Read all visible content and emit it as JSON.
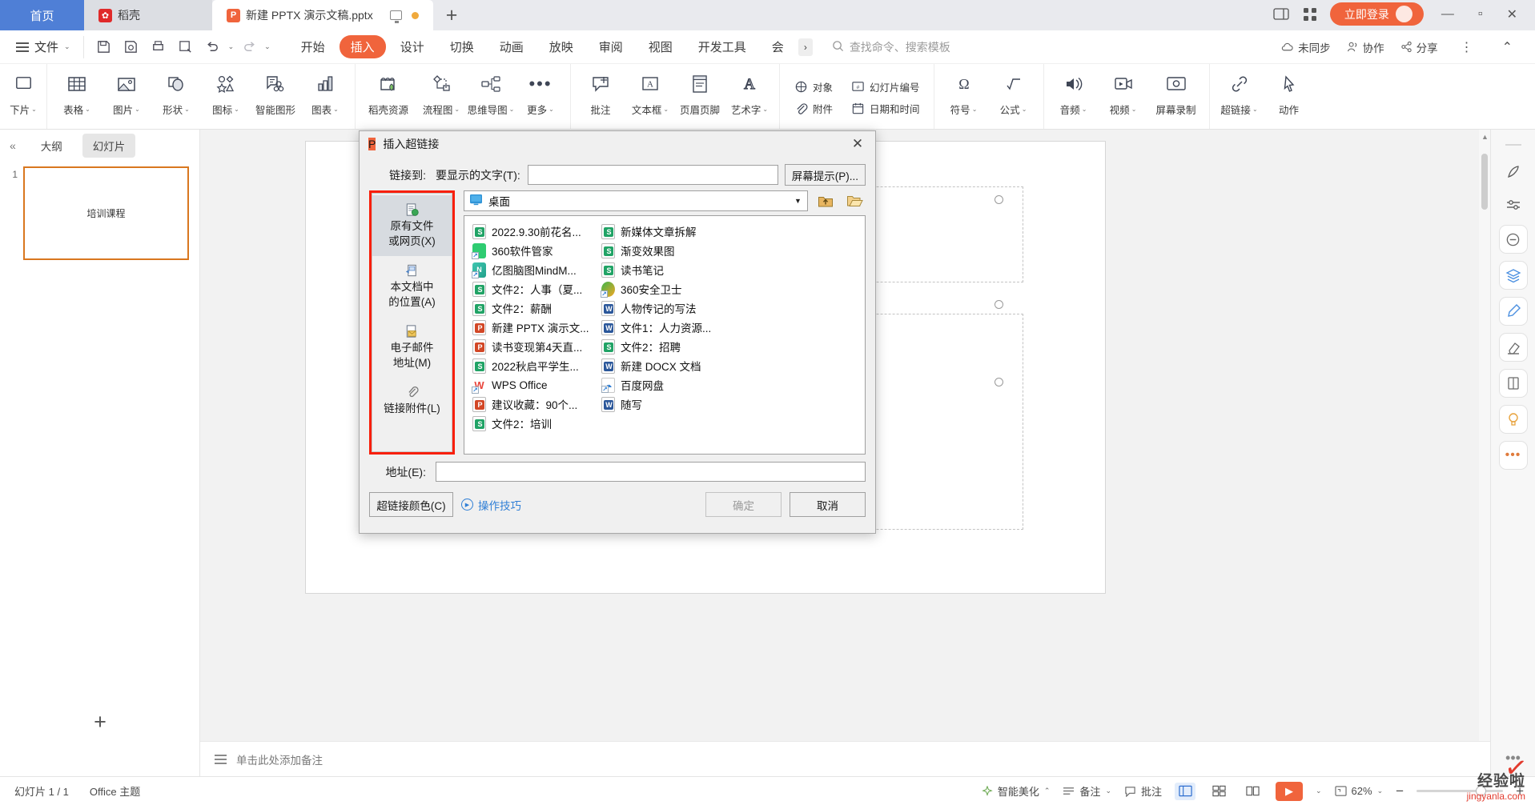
{
  "titlebar": {
    "home_tab": "首页",
    "daoke_tab": "稻壳",
    "doc_tab": "新建 PPTX 演示文稿.pptx",
    "login_label": "立即登录"
  },
  "menubar": {
    "file_label": "文件",
    "tabs": [
      "开始",
      "插入",
      "设计",
      "切换",
      "动画",
      "放映",
      "审阅",
      "视图",
      "开发工具",
      "会"
    ],
    "selected_tab": "插入",
    "more_arrow": "›",
    "search_placeholder": "查找命令、搜索模板",
    "right_items": [
      "未同步",
      "协作",
      "分享"
    ]
  },
  "ribbon": {
    "items": [
      {
        "label": "下片",
        "caret": "⌄"
      },
      {
        "label": "表格",
        "caret": "⌄"
      },
      {
        "label": "图片",
        "caret": "⌄"
      },
      {
        "label": "形状",
        "caret": "⌄"
      },
      {
        "label": "图标",
        "caret": "⌄"
      },
      {
        "label": "智能图形",
        "caret": ""
      },
      {
        "label": "图表",
        "caret": "⌄"
      },
      {
        "label": "稻壳资源",
        "caret": ""
      },
      {
        "label": "流程图",
        "caret": "⌄"
      },
      {
        "label": "思维导图",
        "caret": "⌄"
      },
      {
        "label": "更多",
        "caret": "⌄"
      },
      {
        "label": "批注",
        "caret": ""
      },
      {
        "label": "文本框",
        "caret": "⌄"
      },
      {
        "label": "页眉页脚",
        "caret": ""
      },
      {
        "label": "艺术字",
        "caret": "⌄"
      }
    ],
    "stack_a": [
      "对象",
      "幻灯片编号",
      "附件",
      "日期和时间"
    ],
    "items_tail": [
      {
        "label": "符号",
        "caret": "⌄"
      },
      {
        "label": "公式",
        "caret": "⌄"
      },
      {
        "label": "音频",
        "caret": "⌄"
      },
      {
        "label": "视频",
        "caret": "⌄"
      },
      {
        "label": "屏幕录制",
        "caret": ""
      },
      {
        "label": "超链接",
        "caret": "⌄"
      },
      {
        "label": "动作",
        "caret": ""
      }
    ]
  },
  "leftpanel": {
    "outline_tab": "大纲",
    "slides_tab": "幻灯片",
    "slide_number": "1",
    "slide_title": "培训课程",
    "add_slide": "+"
  },
  "notes": {
    "placeholder": "单击此处添加备注"
  },
  "status": {
    "slide_count": "幻灯片 1 / 1",
    "theme": "Office 主题",
    "beautify": "智能美化",
    "notes": "备注",
    "comments": "批注",
    "zoom": "62%",
    "zoom_out": "−",
    "zoom_in": "+"
  },
  "watermark": {
    "cn": "经验啦",
    "en": "jingyanla.com"
  },
  "dialog": {
    "title": "插入超链接",
    "close": "✕",
    "link_to_label": "链接到:",
    "display_text_label": "要显示的文字(T):",
    "display_text_value": "",
    "screen_tip_button": "屏幕提示(P)...",
    "sidebar": [
      {
        "label_line1": "原有文件",
        "label_line2": "或网页(X)",
        "icon": "existing-file-icon",
        "selected": true
      },
      {
        "label_line1": "本文档中",
        "label_line2": "的位置(A)",
        "icon": "place-in-doc-icon",
        "selected": false
      },
      {
        "label_line1": "电子邮件",
        "label_line2": "地址(M)",
        "icon": "email-icon",
        "selected": false
      },
      {
        "label_line1": "链接附件(L)",
        "label_line2": "",
        "icon": "attachment-icon",
        "selected": false
      }
    ],
    "look_in_value": "桌面",
    "up_folder_title": "上一级",
    "browse_title": "浏览",
    "files": [
      {
        "name": "2022.9.30前花名...",
        "type": "xls"
      },
      {
        "name": "360软件管家",
        "type": "sw360"
      },
      {
        "name": "亿图脑图MindM...",
        "type": "mind"
      },
      {
        "name": "文件2：人事（夏...",
        "type": "xls"
      },
      {
        "name": "文件2：薪酬",
        "type": "xls"
      },
      {
        "name": "新建 PPTX 演示文...",
        "type": "ppt"
      },
      {
        "name": "读书变现第4天直...",
        "type": "ppt"
      },
      {
        "name": "2022秋启平学生...",
        "type": "xls"
      },
      {
        "name": "WPS Office",
        "type": "wps"
      },
      {
        "name": "建议收藏：90个...",
        "type": "ppt"
      },
      {
        "name": "文件2：培训",
        "type": "xls"
      },
      {
        "name": "新媒体文章拆解",
        "type": "xls"
      },
      {
        "name": "渐变效果图",
        "type": "xls"
      },
      {
        "name": "读书笔记",
        "type": "xls"
      },
      {
        "name": "360安全卫士",
        "type": "app360"
      },
      {
        "name": "人物传记的写法",
        "type": "doc"
      },
      {
        "name": "文件1：人力资源...",
        "type": "doc"
      },
      {
        "name": "文件2：招聘",
        "type": "xls"
      },
      {
        "name": "新建 DOCX 文档",
        "type": "doc"
      },
      {
        "name": "百度网盘",
        "type": "baidu"
      },
      {
        "name": "随写",
        "type": "doc"
      }
    ],
    "address_label": "地址(E):",
    "address_value": "",
    "hyperlink_color_button": "超链接颜色(C)",
    "tips_link": "操作技巧",
    "ok_button": "确定",
    "cancel_button": "取消"
  }
}
